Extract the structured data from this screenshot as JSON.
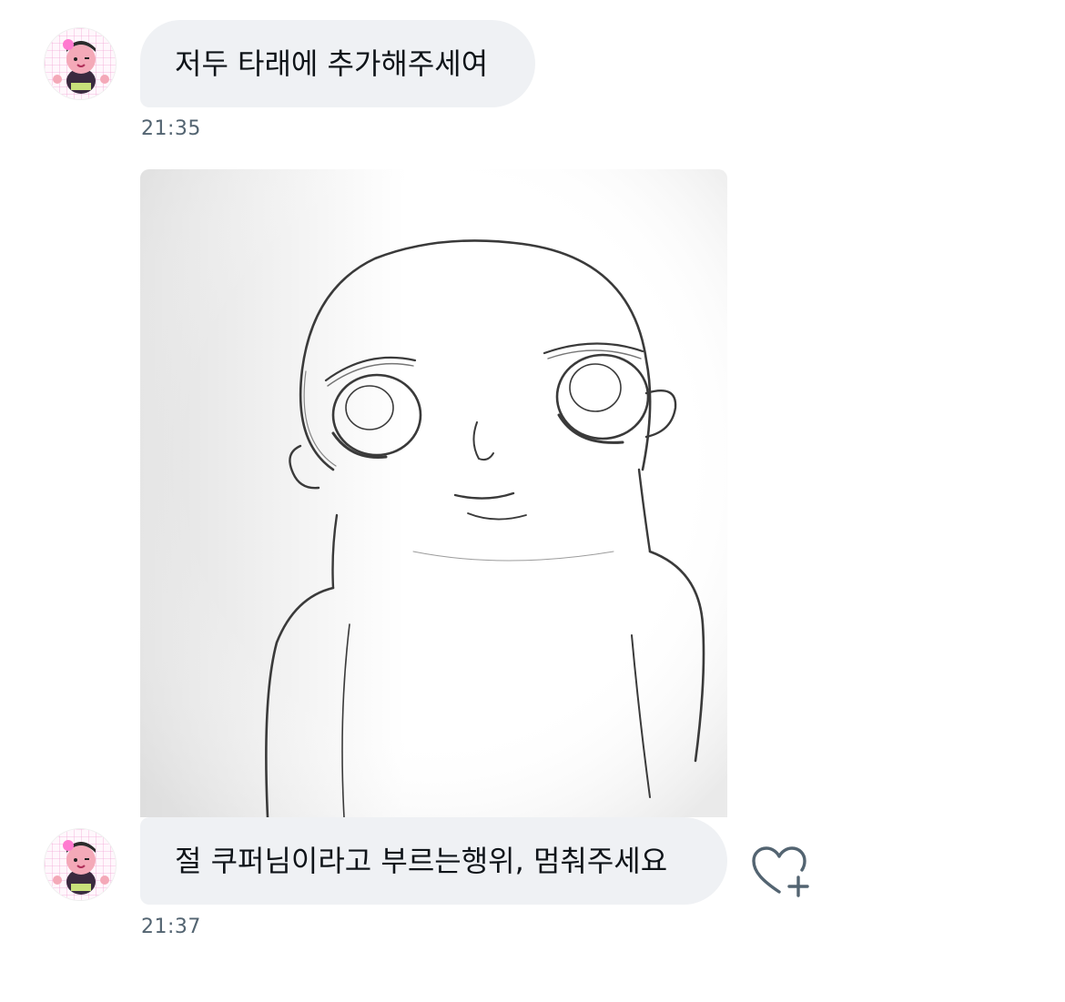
{
  "messages": [
    {
      "text": "저두 타래에 추가해주세여",
      "time": "21:35"
    },
    {
      "text": "절 쿠퍼님이라고 부르는행위, 멈춰주세요",
      "time": "21:37"
    }
  ],
  "icons": {
    "avatar": "avatar-icon",
    "reaction": "heart-plus-icon"
  },
  "colors": {
    "bubble_bg": "#eff1f4",
    "text": "#0f1419",
    "timestamp": "#536471",
    "icon": "#536471"
  }
}
